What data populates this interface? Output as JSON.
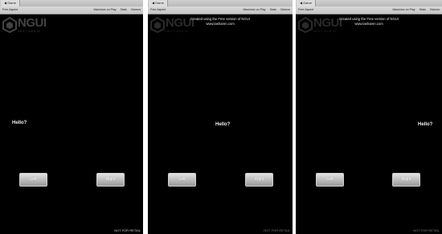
{
  "tab_label": "Game",
  "toolbar": {
    "aspect": "Free Aspect",
    "maximize": "Maximize on Play",
    "stats": "Stats",
    "gizmos": "Gizmos"
  },
  "logo": {
    "word": "NGUI",
    "sub": "NEXT-GEN UI"
  },
  "free_notice": {
    "line1": "Created using the Free version of NGUI",
    "line2": "www.tasharen.com"
  },
  "scene": {
    "hello": "Hello?",
    "left_button": "Left",
    "right_button": "Right",
    "not_for_retail": "NOT FOR RETAIL"
  }
}
